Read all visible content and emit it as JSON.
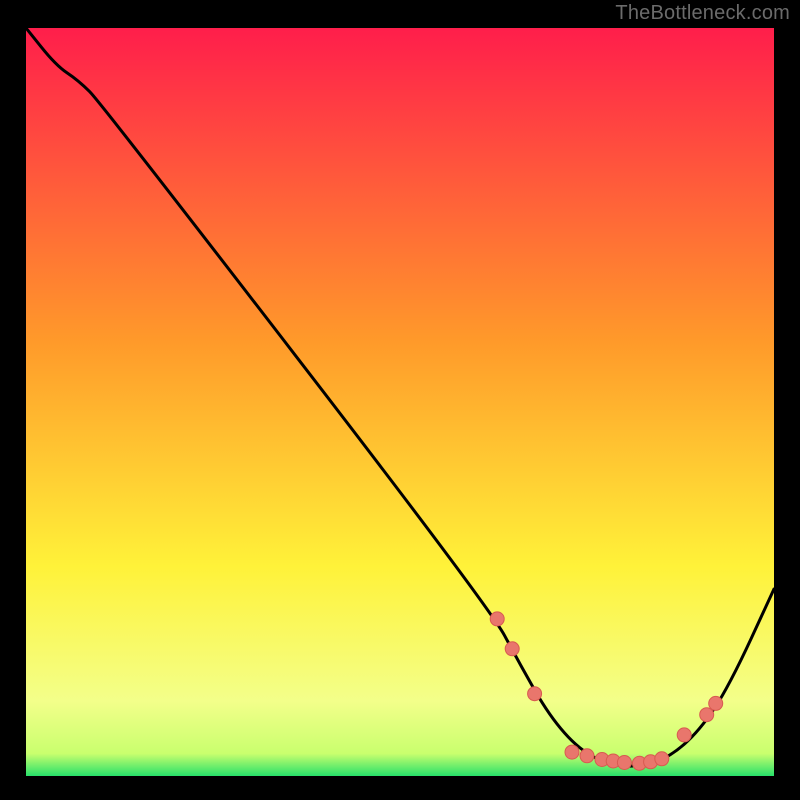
{
  "attribution": "TheBottleneck.com",
  "colors": {
    "bg": "#000000",
    "curve": "#000000",
    "dot_fill": "#e9766c",
    "dot_stroke": "#d85a50",
    "grad_top": "#ff1e4b",
    "grad_mid1": "#ff9a2a",
    "grad_mid2": "#fff239",
    "grad_band": "#f3ff8a",
    "grad_bot": "#27e06a"
  },
  "chart_data": {
    "type": "line",
    "title": "",
    "xlabel": "",
    "ylabel": "",
    "xlim": [
      0,
      100
    ],
    "ylim": [
      0,
      100
    ],
    "curve": [
      {
        "x": 0,
        "y": 100
      },
      {
        "x": 4,
        "y": 95
      },
      {
        "x": 7,
        "y": 93
      },
      {
        "x": 10,
        "y": 90
      },
      {
        "x": 62,
        "y": 22.5
      },
      {
        "x": 66,
        "y": 15
      },
      {
        "x": 70,
        "y": 8
      },
      {
        "x": 74,
        "y": 3.5
      },
      {
        "x": 78,
        "y": 1.5
      },
      {
        "x": 82,
        "y": 1.2
      },
      {
        "x": 86,
        "y": 2.5
      },
      {
        "x": 90,
        "y": 6
      },
      {
        "x": 94,
        "y": 12
      },
      {
        "x": 100,
        "y": 25
      }
    ],
    "dots": [
      {
        "x": 63,
        "y": 21
      },
      {
        "x": 65,
        "y": 17
      },
      {
        "x": 68,
        "y": 11
      },
      {
        "x": 73,
        "y": 3.2
      },
      {
        "x": 75,
        "y": 2.7
      },
      {
        "x": 77,
        "y": 2.2
      },
      {
        "x": 78.5,
        "y": 2.0
      },
      {
        "x": 80,
        "y": 1.8
      },
      {
        "x": 82,
        "y": 1.7
      },
      {
        "x": 83.5,
        "y": 1.9
      },
      {
        "x": 85,
        "y": 2.3
      },
      {
        "x": 88,
        "y": 5.5
      },
      {
        "x": 91,
        "y": 8.2
      },
      {
        "x": 92.2,
        "y": 9.7
      }
    ]
  }
}
